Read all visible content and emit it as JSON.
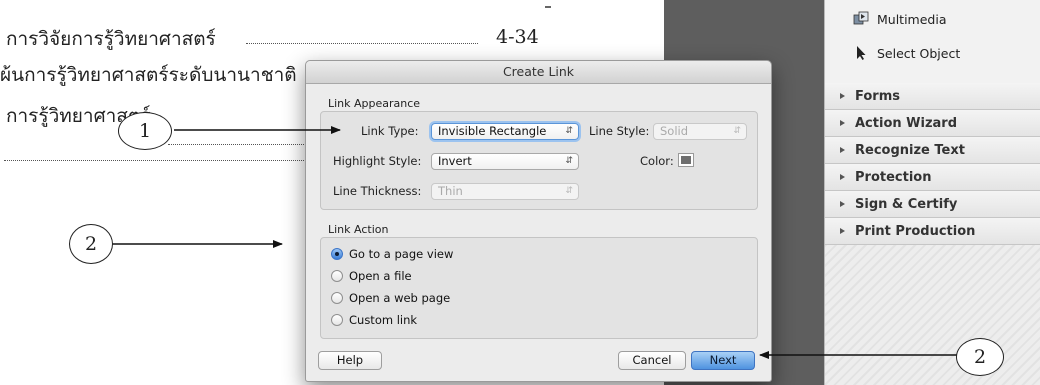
{
  "document": {
    "line1_text": "การวิจัยการรู้วิทยาศาสตร์",
    "line1_page": "4-34",
    "line2_text": "ผ้นการรู้วิทยาศาสตร์ระดับนานาชาติ",
    "line3_text": "การรู้วิทยาศาสตร์"
  },
  "tools_panel": {
    "items": [
      {
        "label": "Multimedia",
        "icon": "multimedia-icon"
      },
      {
        "label": "Select Object",
        "icon": "select-object-arrow-icon"
      }
    ],
    "sections": [
      "Forms",
      "Action Wizard",
      "Recognize Text",
      "Protection",
      "Sign & Certify",
      "Print Production"
    ]
  },
  "dialog": {
    "title": "Create Link",
    "appearance": {
      "group_label": "Link Appearance",
      "link_type_label": "Link Type:",
      "link_type_value": "Invisible Rectangle",
      "line_style_label": "Line Style:",
      "line_style_value": "Solid",
      "highlight_style_label": "Highlight Style:",
      "highlight_style_value": "Invert",
      "color_label": "Color:",
      "color_swatch": "#6f6f6f",
      "line_thickness_label": "Line Thickness:",
      "line_thickness_value": "Thin"
    },
    "action": {
      "group_label": "Link Action",
      "options": [
        {
          "label": "Go to a page view",
          "selected": true
        },
        {
          "label": "Open a file",
          "selected": false
        },
        {
          "label": "Open a web page",
          "selected": false
        },
        {
          "label": "Custom link",
          "selected": false
        }
      ]
    },
    "buttons": {
      "help": "Help",
      "cancel": "Cancel",
      "next": "Next"
    }
  },
  "annotations": {
    "callout_1": "1",
    "callout_2_left": "2",
    "callout_2_right": "2"
  },
  "colors": {
    "accent": "#4f93e0",
    "gutter": "#5e5e5e"
  }
}
